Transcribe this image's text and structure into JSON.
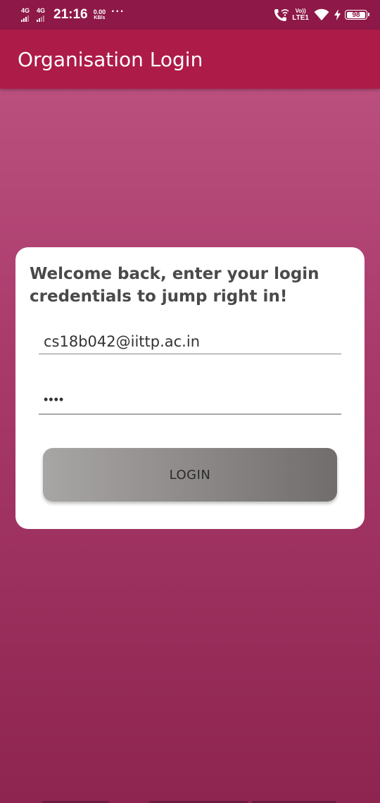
{
  "status_bar": {
    "sim1_network": "4G",
    "sim2_network": "4G",
    "time": "21:16",
    "speed_value": "0.00",
    "speed_unit": "KB/s",
    "more_dots": "···",
    "volte_top": "Vo))",
    "volte_bottom": "LTE1",
    "battery_level": "98"
  },
  "app_bar": {
    "title": "Organisation Login",
    "background_color": "#ad1b48"
  },
  "login_card": {
    "welcome_text": "Welcome back, enter your login credentials to jump right in!",
    "email_value": "cs18b042@iittp.ac.in",
    "password_masked": "••••",
    "login_button_label": "LOGIN"
  },
  "colors": {
    "status_bar": "#8e1848",
    "background_top": "#c05684",
    "background_bottom": "#8e2450",
    "button_gradient_start": "#a8a6a5",
    "button_gradient_end": "#716d6c"
  },
  "icons": [
    "wifi-calling-icon",
    "wifi-icon",
    "charging-icon",
    "battery-icon"
  ]
}
